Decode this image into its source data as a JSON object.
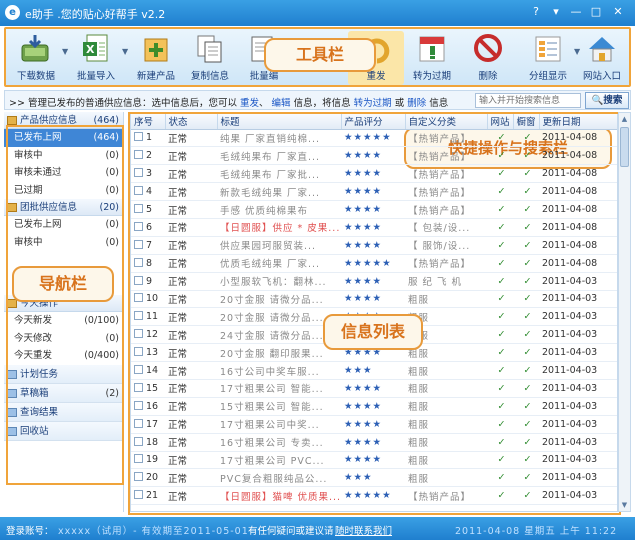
{
  "window": {
    "title": "e助手 .您的贴心好帮手 v2.2",
    "help_glyph": "?",
    "menu_glyph": "▾",
    "minimize_glyph": "—",
    "maximize_glyph": "□",
    "close_glyph": "✕"
  },
  "toolbar": {
    "items": [
      {
        "label": "下载数据",
        "icon": "download-icon"
      },
      {
        "label": "批量导入",
        "icon": "excel-import-icon"
      },
      {
        "label": "新建产品",
        "icon": "new-product-icon"
      },
      {
        "label": "复制信息",
        "icon": "copy-icon"
      },
      {
        "label": "批量编",
        "icon": "batch-edit-icon"
      },
      {
        "label": "重发",
        "icon": "republish-icon"
      },
      {
        "label": "转为过期",
        "icon": "expire-icon"
      },
      {
        "label": "删除",
        "icon": "delete-icon"
      },
      {
        "label": "分组显示",
        "icon": "group-icon"
      },
      {
        "label": "网站入口",
        "icon": "home-icon"
      }
    ],
    "callout": "工具栏"
  },
  "quickbar": {
    "prefix": ">> 管理已发布的普通供应信息：选中信息后，您可以",
    "link_republish": "重发",
    "sep1": "、",
    "link_edit": "编辑",
    "mid": "信息，将信息",
    "link_expire": "转为过期",
    "or": "或",
    "link_delete": "删除",
    "suffix": "信息",
    "search_placeholder": "输入并开始搜索信息",
    "search_button": "搜索",
    "callout": "快捷操作与搜索栏"
  },
  "sidebar": {
    "callout": "导航栏",
    "groups": [
      {
        "title": "产品供应信息",
        "count": "(464)",
        "items": [
          {
            "label": "已发布上网",
            "count": "(464)",
            "selected": true
          },
          {
            "label": "审核中",
            "count": "(0)"
          },
          {
            "label": "审核未通过",
            "count": "(0)"
          },
          {
            "label": "已过期",
            "count": "(0)"
          }
        ]
      },
      {
        "title": "团批供应信息",
        "count": "(20)",
        "items": [
          {
            "label": "已发布上网",
            "count": "(0)"
          },
          {
            "label": "审核中",
            "count": "(0)"
          }
        ]
      },
      {
        "title": "今天操作",
        "count": "",
        "items": [
          {
            "label": "今天新发",
            "count": "(0/100)"
          },
          {
            "label": "今天修改",
            "count": "(0)"
          },
          {
            "label": "今天重发",
            "count": "(0/400)"
          }
        ]
      }
    ],
    "flat": [
      {
        "label": "计划任务",
        "count": ""
      },
      {
        "label": "草稿箱",
        "count": "(2)"
      },
      {
        "label": "查询结果",
        "count": ""
      },
      {
        "label": "回收站",
        "count": ""
      }
    ]
  },
  "table": {
    "callout": "信息列表",
    "columns": [
      "序号",
      "状态",
      "标题",
      "产品评分",
      "自定义分类",
      "网站",
      "橱窗",
      "更新日期"
    ],
    "rows": [
      {
        "no": "1",
        "status": "正常",
        "title": "纯果 厂家直销纯棉...",
        "red": false,
        "rating": "★★★★★",
        "cat": "【热销产品】",
        "web": "✓",
        "show": "✓",
        "date": "2011-04-08"
      },
      {
        "no": "2",
        "status": "正常",
        "title": "毛绒纯果布 厂家直...",
        "red": false,
        "rating": "★★★★",
        "cat": "【热销产品】",
        "web": "✓",
        "show": "✓",
        "date": "2011-04-08"
      },
      {
        "no": "3",
        "status": "正常",
        "title": "毛绒纯果布 厂家批...",
        "red": false,
        "rating": "★★★★",
        "cat": "【热销产品】",
        "web": "✓",
        "show": "✓",
        "date": "2011-04-08"
      },
      {
        "no": "4",
        "status": "正常",
        "title": "新款毛绒纯果 厂家...",
        "red": false,
        "rating": "★★★★",
        "cat": "【热销产品】",
        "web": "✓",
        "show": "✓",
        "date": "2011-04-08"
      },
      {
        "no": "5",
        "status": "正常",
        "title": "手感 优质纯棉果布",
        "red": false,
        "rating": "★★★★",
        "cat": "【热销产品】",
        "web": "✓",
        "show": "✓",
        "date": "2011-04-08"
      },
      {
        "no": "6",
        "status": "正常",
        "title": "【日圆服】供应 * 皮果...",
        "red": true,
        "rating": "★★★★",
        "cat": "【 包装/设...",
        "web": "✓",
        "show": "✓",
        "date": "2011-04-08"
      },
      {
        "no": "7",
        "status": "正常",
        "title": "供应果园珂服贸装...",
        "red": false,
        "rating": "★★★★",
        "cat": "【 服饰/设...",
        "web": "✓",
        "show": "✓",
        "date": "2011-04-08"
      },
      {
        "no": "8",
        "status": "正常",
        "title": "优质毛绒纯果 厂家...",
        "red": false,
        "rating": "★★★★★",
        "cat": "【热销产品】",
        "web": "✓",
        "show": "✓",
        "date": "2011-04-08"
      },
      {
        "no": "9",
        "status": "正常",
        "title": "小型服软飞机：翻林...",
        "red": false,
        "rating": "★★★★",
        "cat": "服 纪 飞 机",
        "web": "✓",
        "show": "✓",
        "date": "2011-04-03"
      },
      {
        "no": "10",
        "status": "正常",
        "title": "20寸金服 请微分品...",
        "red": false,
        "rating": "★★★★",
        "cat": "粗服",
        "web": "✓",
        "show": "✓",
        "date": "2011-04-03"
      },
      {
        "no": "11",
        "status": "正常",
        "title": "20寸金服 请微分品...",
        "red": false,
        "rating": "★★★★",
        "cat": "粗服",
        "web": "✓",
        "show": "✓",
        "date": "2011-04-03"
      },
      {
        "no": "12",
        "status": "正常",
        "title": "24寸金服 请微分品...",
        "red": false,
        "rating": "★★★★",
        "cat": "粗服",
        "web": "✓",
        "show": "✓",
        "date": "2011-04-03"
      },
      {
        "no": "13",
        "status": "正常",
        "title": "20寸金服 翻印服果...",
        "red": false,
        "rating": "★★★★",
        "cat": "粗服",
        "web": "✓",
        "show": "✓",
        "date": "2011-04-03"
      },
      {
        "no": "14",
        "status": "正常",
        "title": "16寸公司中奖车服...",
        "red": false,
        "rating": "★★★",
        "cat": "粗服",
        "web": "✓",
        "show": "✓",
        "date": "2011-04-03"
      },
      {
        "no": "15",
        "status": "正常",
        "title": "17寸粗果公司 智能...",
        "red": false,
        "rating": "★★★★",
        "cat": "粗服",
        "web": "✓",
        "show": "✓",
        "date": "2011-04-03"
      },
      {
        "no": "16",
        "status": "正常",
        "title": "15寸粗果公司 智能...",
        "red": false,
        "rating": "★★★★",
        "cat": "粗服",
        "web": "✓",
        "show": "✓",
        "date": "2011-04-03"
      },
      {
        "no": "17",
        "status": "正常",
        "title": "17寸粗果公司中奖...",
        "red": false,
        "rating": "★★★★",
        "cat": "粗服",
        "web": "✓",
        "show": "✓",
        "date": "2011-04-03"
      },
      {
        "no": "18",
        "status": "正常",
        "title": "16寸粗果公司 专卖...",
        "red": false,
        "rating": "★★★★",
        "cat": "粗服",
        "web": "✓",
        "show": "✓",
        "date": "2011-04-03"
      },
      {
        "no": "19",
        "status": "正常",
        "title": "17寸粗果公司 PVC...",
        "red": false,
        "rating": "★★★★",
        "cat": "粗服",
        "web": "✓",
        "show": "✓",
        "date": "2011-04-03"
      },
      {
        "no": "20",
        "status": "正常",
        "title": "PVC复合粗服纯品公...",
        "red": false,
        "rating": "★★★",
        "cat": "粗服",
        "web": "✓",
        "show": "✓",
        "date": "2011-04-03"
      },
      {
        "no": "21",
        "status": "正常",
        "title": "【日圆服】猫啤 优质果...",
        "red": true,
        "rating": "★★★★★",
        "cat": "【热销产品】",
        "web": "✓",
        "show": "✓",
        "date": "2011-04-03"
      }
    ]
  },
  "statusbar": {
    "login_label": "登录账号：",
    "account_blurred": "xxxxx（试用）- 有效期至2011-05-01",
    "feedback": "有任何疑问或建议请",
    "contact_link": "随时联系我们",
    "right_blurred": "2011-04-08 星期五 上午 11:22"
  },
  "colors": {
    "accent": "#1f7fcf",
    "highlight_border": "#f0a43a",
    "callout_text": "#d8731c",
    "selected_row": "#3f86d6"
  }
}
